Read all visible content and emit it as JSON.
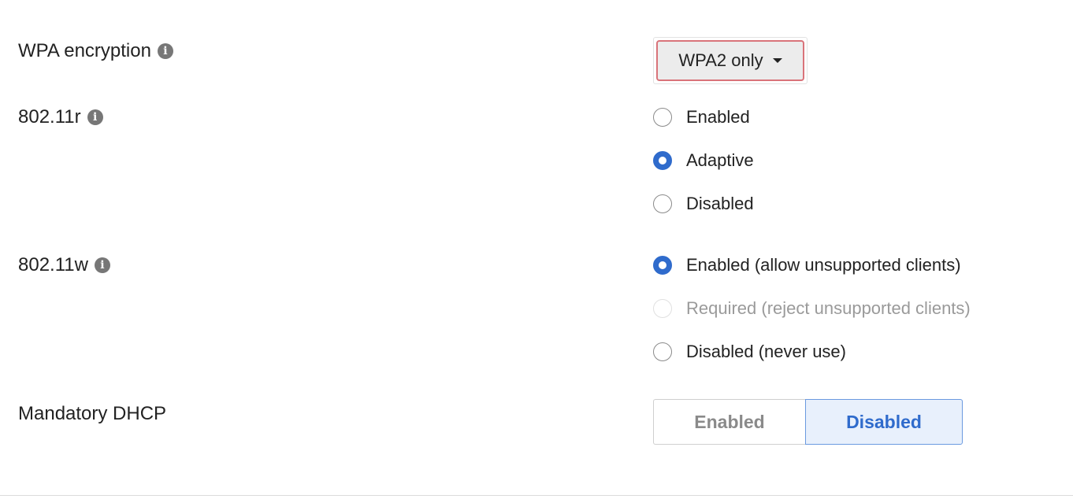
{
  "wpa_encryption": {
    "label": "WPA encryption",
    "info_icon": "info-icon",
    "selected": "WPA2 only"
  },
  "fast_roaming": {
    "label": "802.11r",
    "info_icon": "info-icon",
    "options": [
      {
        "label": "Enabled",
        "checked": false,
        "disabled": false
      },
      {
        "label": "Adaptive",
        "checked": true,
        "disabled": false
      },
      {
        "label": "Disabled",
        "checked": false,
        "disabled": false
      }
    ]
  },
  "mfp": {
    "label": "802.11w",
    "info_icon": "info-icon",
    "options": [
      {
        "label": "Enabled (allow unsupported clients)",
        "checked": true,
        "disabled": false
      },
      {
        "label": "Required (reject unsupported clients)",
        "checked": false,
        "disabled": true
      },
      {
        "label": "Disabled (never use)",
        "checked": false,
        "disabled": false
      }
    ]
  },
  "mandatory_dhcp": {
    "label": "Mandatory DHCP",
    "options": [
      "Enabled",
      "Disabled"
    ],
    "selected": "Disabled"
  },
  "colors": {
    "accent": "#2f6bcc",
    "dropdown_border": "#d9737a",
    "selected_bg": "#e8f0fc"
  }
}
